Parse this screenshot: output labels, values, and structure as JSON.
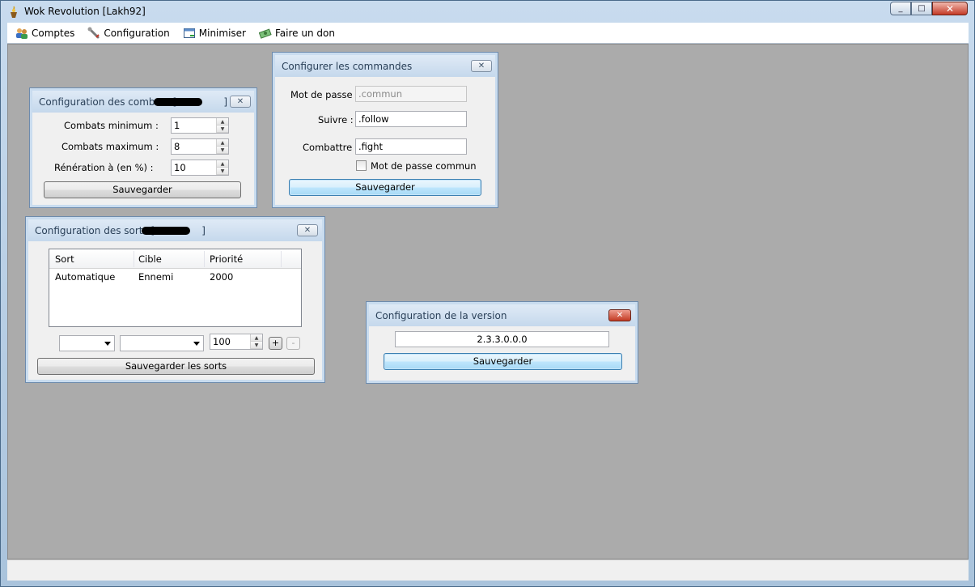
{
  "window": {
    "title": "Wok Revolution [Lakh92]",
    "min": "_",
    "max": "□",
    "close": "✕"
  },
  "menu": [
    {
      "label": "Comptes",
      "icon": "users-icon"
    },
    {
      "label": "Configuration",
      "icon": "wrench-icon"
    },
    {
      "label": "Minimiser",
      "icon": "minimize-window-icon"
    },
    {
      "label": "Faire un don",
      "icon": "money-icon"
    }
  ],
  "combats": {
    "title": "Configuration des combats [",
    "title_end": "]",
    "close": "✕",
    "min_label": "Combats minimum :",
    "min_value": "1",
    "max_label": "Combats maximum :",
    "max_value": "8",
    "regen_label": "Rénération à (en %)  :",
    "regen_value": "10",
    "save": "Sauvegarder"
  },
  "commandes": {
    "title": "Configurer les commandes",
    "close": "✕",
    "password_label": "Mot de passe :",
    "password_placeholder": ".commun",
    "follow_label": "Suivre :",
    "follow_value": ".follow",
    "fight_label": "Combattre :",
    "fight_value": ".fight",
    "common_pw_label": "Mot de passe commun",
    "save": "Sauvegarder"
  },
  "sorts": {
    "title": "Configuration des sorts [",
    "title_end": "]",
    "close": "✕",
    "columns": [
      "Sort",
      "Cible",
      "Priorité"
    ],
    "rows": [
      [
        "Automatique",
        "Ennemi",
        "2000"
      ]
    ],
    "priority_value": "100",
    "add": "+",
    "remove": "-",
    "save": "Sauvegarder les sorts"
  },
  "version": {
    "title": "Configuration de la version",
    "close": "✕",
    "value": "2.3.3.0.0.0",
    "save": "Sauvegarder"
  },
  "colors": {
    "mdi_background": "#ababab",
    "close_red": "#c33a23",
    "accent": "#3c7fb1"
  }
}
